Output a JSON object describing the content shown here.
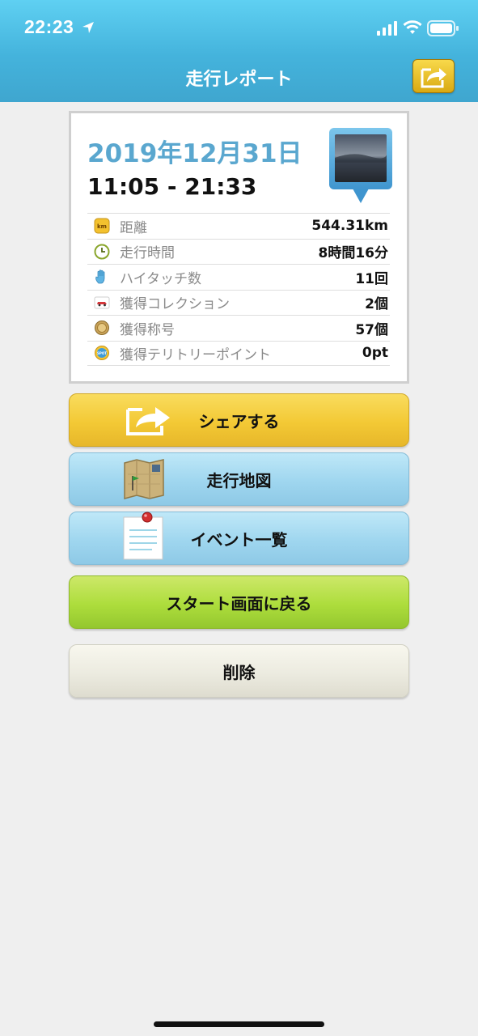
{
  "status_bar": {
    "time": "22:23"
  },
  "nav": {
    "title": "走行レポート"
  },
  "report": {
    "date": "2019年12月31日",
    "time_range": "11:05 - 21:33",
    "stats": [
      {
        "icon": "km-icon",
        "label": "距離",
        "value": "544.31km"
      },
      {
        "icon": "clock-icon",
        "label": "走行時間",
        "value": "8時間16分"
      },
      {
        "icon": "hand-icon",
        "label": "ハイタッチ数",
        "value": "11回"
      },
      {
        "icon": "car-icon",
        "label": "獲得コレクション",
        "value": "2個"
      },
      {
        "icon": "medal-icon",
        "label": "獲得称号",
        "value": "57個"
      },
      {
        "icon": "spot-icon",
        "label": "獲得テリトリーポイント",
        "value": "0pt"
      }
    ],
    "km_badge": "km",
    "spot_badge": "SPOT"
  },
  "buttons": {
    "share": "シェアする",
    "map": "走行地図",
    "events": "イベント一覧",
    "back_to_start": "スタート画面に戻る",
    "delete": "削除"
  },
  "colors": {
    "header": "#44b3dc",
    "date": "#5aa7cf",
    "share_button": "#f3c935",
    "map_button": "#9fd6ef",
    "start_button": "#addd3c",
    "delete_button": "#ecebe0"
  }
}
